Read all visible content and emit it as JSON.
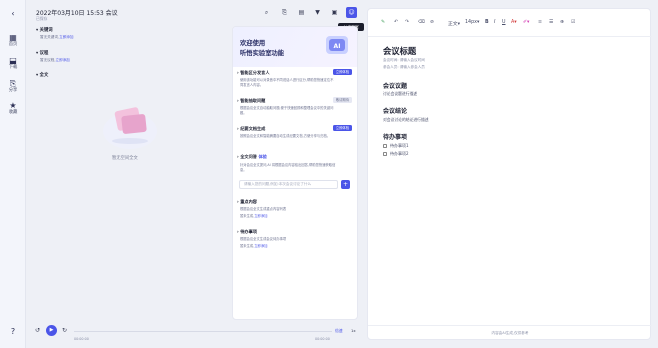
{
  "rail": {
    "items": [
      {
        "icon": "home-icon",
        "label": "首页"
      },
      {
        "icon": "download-icon",
        "label": "下载"
      },
      {
        "icon": "share-icon",
        "label": "分享"
      },
      {
        "icon": "star-icon",
        "label": "收藏"
      }
    ],
    "help_icon": "help-icon"
  },
  "header": {
    "title": "2022年03月10日 15:53 会议",
    "subtitle": "已保存",
    "ai_tooltip": "AI 实验室"
  },
  "outline": {
    "sections": [
      {
        "title": "关键词",
        "desc": "暂无关键词,",
        "link": "立即添加"
      },
      {
        "title": "议程",
        "desc": "暂无议程,",
        "link": "立即添加"
      },
      {
        "title": "全文",
        "desc": "",
        "link": ""
      }
    ],
    "empty_text": "暂无空间全文"
  },
  "assistant": {
    "hero_line1": "欢迎使用",
    "hero_line2": "听悟实验室功能",
    "cards": [
      {
        "title": "智能区分发言人",
        "pill": "立即体验",
        "desc": "使用该功能可以对录音中不同说话人进行区分,帮助您快速定位不同发言人内容。"
      },
      {
        "title": "智能抽取问题",
        "pill": "敬请期待",
        "desc": "根据会议全文自动抽取问题,便于快速回顾和整理会议中的关键问题。"
      },
      {
        "title": "纪要文档生成",
        "pill": "立即体验",
        "desc": "按照会议全文和智能摘要自动生成纪要文档,方便分享与归档。"
      }
    ],
    "qa_title": "全文问答",
    "qa_tag": "体验",
    "qa_desc": "针对会议全文提问,AI 将根据会议内容给出回答,帮助您快速获取信息。",
    "ask_placeholder": "请输入您的问题,例如:本次会议讨论了什么",
    "ask_icon": "plus-icon",
    "todo_title": "重点内容",
    "todo_desc": "根据会议全文生成重点内容列表",
    "todo_empty": "暂未生成,",
    "todo_link": "立即添加",
    "task_title": "待办事项",
    "task_desc": "根据会议全文生成会议待办事项",
    "task_empty": "暂未生成,",
    "task_link": "立即添加"
  },
  "player": {
    "time_current": "00:00:00",
    "time_total": "00:00:00",
    "speed_label": "倍速",
    "rate_label": "1x"
  },
  "editor": {
    "font_size": "14px",
    "font_label": "正文",
    "title": "会议标题",
    "meta_time": "会议时间: 请输入会议时间",
    "meta_people": "参会人员: 请输入参会人员",
    "h_agenda": "会议议题",
    "p_agenda": "讨论会议题进行描述",
    "h_conclusion": "会议结论",
    "p_conclusion": "对会议讨论的结论进行描述",
    "h_todo": "待办事项",
    "todo_items": [
      "待办事项1",
      "待办事项2"
    ],
    "footer": "内容由AI生成,仅供参考"
  },
  "colors": {
    "accent": "#4b55e8",
    "bg": "#eef0f6",
    "panel": "#ffffff",
    "ink": "#1f2233"
  }
}
